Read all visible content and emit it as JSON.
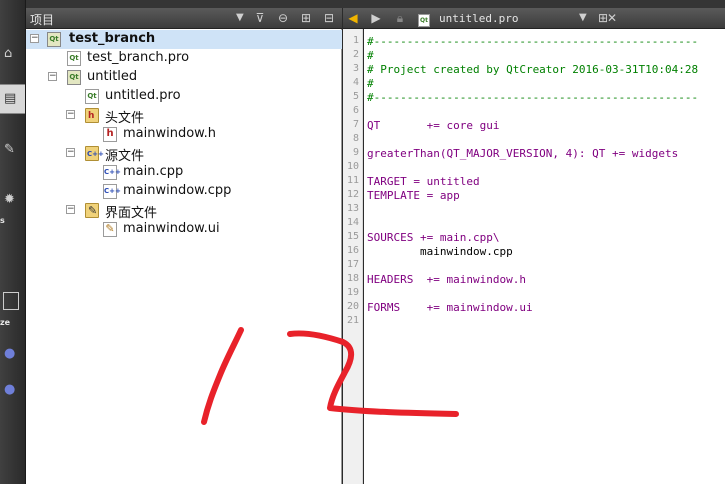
{
  "project_panel": {
    "title": "项目",
    "tree": [
      {
        "label": "test_branch",
        "bold": true,
        "selected": true,
        "icon": "qt-project-icon",
        "expander": "−"
      },
      {
        "label": "test_branch.pro",
        "icon": "pro-file-icon"
      },
      {
        "label": "untitled",
        "icon": "qt-project-icon",
        "expander": "−"
      },
      {
        "label": "untitled.pro",
        "icon": "pro-file-icon"
      },
      {
        "label": "头文件",
        "icon": "header-folder-icon",
        "expander": "−"
      },
      {
        "label": "mainwindow.h",
        "icon": "h-file-icon"
      },
      {
        "label": "源文件",
        "icon": "source-folder-icon",
        "expander": "−"
      },
      {
        "label": "main.cpp",
        "icon": "cpp-file-icon"
      },
      {
        "label": "mainwindow.cpp",
        "icon": "cpp-file-icon"
      },
      {
        "label": "界面文件",
        "icon": "forms-folder-icon",
        "expander": "−"
      },
      {
        "label": "mainwindow.ui",
        "icon": "ui-file-icon"
      }
    ]
  },
  "modebar": {
    "label_s": "s",
    "label_ze": "ze"
  },
  "editor": {
    "file_name": "untitled.pro",
    "line_numbers": [
      "1",
      "2",
      "3",
      "4",
      "5",
      "6",
      "7",
      "8",
      "9",
      "10",
      "11",
      "12",
      "13",
      "14",
      "15",
      "16",
      "17",
      "18",
      "19",
      "20",
      "21"
    ],
    "lines": [
      "#-------------------------------------------------",
      "#",
      "# Project created by QtCreator 2016-03-31T10:04:28",
      "#",
      "#-------------------------------------------------",
      "",
      "QT       += core gui",
      "",
      "greaterThan(QT_MAJOR_VERSION, 4): QT += widgets",
      "",
      "TARGET = untitled",
      "TEMPLATE = app",
      "",
      "",
      "SOURCES += main.cpp\\",
      "        mainwindow.cpp",
      "",
      "HEADERS  += mainwindow.h",
      "",
      "FORMS    += mainwindow.ui",
      ""
    ]
  },
  "annotation": {
    "color": "#e8222a",
    "meaning": "hand-drawn 12"
  }
}
